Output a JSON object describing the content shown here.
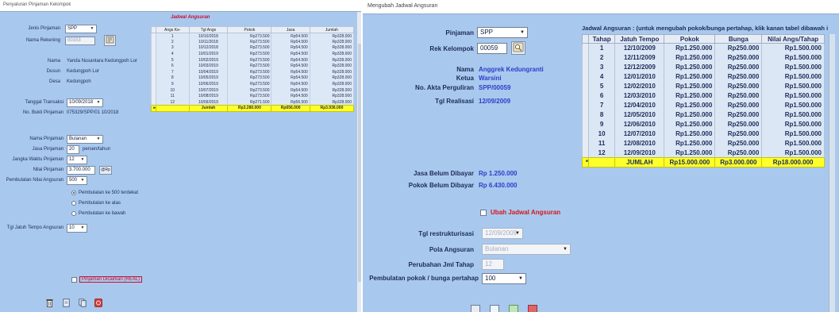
{
  "left_window": {
    "title": "Penyaluran Pinjaman Kelompok",
    "jenis_pinjaman": {
      "label": "Jenis Pinjaman",
      "value": "SPP"
    },
    "nama_rekening": {
      "label": "Nama Rekening",
      "value": "00153"
    },
    "nama": {
      "label": "Nama",
      "value": "Yanda Nusantara Kedungpoh Lor"
    },
    "dusun": {
      "label": "Dusun",
      "value": "Kedungpoh Lor"
    },
    "desa": {
      "label": "Desa",
      "value": "Kedungpoh"
    },
    "tanggal_transaksi": {
      "label": "Tanggal Transaksi",
      "value": "10/09/2018"
    },
    "no_bukti": {
      "label": "No. Bukti Pinjaman",
      "value": "075329/SPP/01 10/2018"
    },
    "nama_pinjaman": {
      "label": "Nama Pinjaman",
      "value": "Bulanan"
    },
    "jasa_pinjaman": {
      "label": "Jasa Pinjaman",
      "value": "20",
      "unit": "persen/tahun"
    },
    "jangka_waktu": {
      "label": "Jangka Waktu Pinjaman",
      "value": "12"
    },
    "nilai_pinjaman": {
      "label": "Nilai Pinjaman",
      "value": "3.700.000",
      "button": "@Rp"
    },
    "pembulatan": {
      "label": "Pembulatan Nilai Angsuran",
      "value": "500"
    },
    "radio_options": [
      "Pembulatan ke 500 terdekat",
      "Pembulatan ke atas",
      "Pembulatan ke bawah"
    ],
    "tgl_jatuh_tempo": {
      "label": "Tgl Jatuh Tempo Angsuran",
      "value": "10"
    },
    "checkbox_label": "Pinjaman Dicairkan (REAL)",
    "schedule": {
      "heading": "Jadwal Angsuran",
      "columns": [
        "Angs Ke-",
        "Tgl Angs",
        "Pokok",
        "Jasa",
        "Jumlah"
      ],
      "rows": [
        [
          "1",
          "10/10/2018",
          "Rp273.500",
          "Rp54.500",
          "Rp328.000"
        ],
        [
          "2",
          "10/11/2018",
          "Rp273.500",
          "Rp54.500",
          "Rp328.000"
        ],
        [
          "3",
          "10/12/2018",
          "Rp273.500",
          "Rp54.500",
          "Rp328.000"
        ],
        [
          "4",
          "10/01/2019",
          "Rp273.500",
          "Rp54.500",
          "Rp328.000"
        ],
        [
          "5",
          "10/02/2019",
          "Rp273.500",
          "Rp54.500",
          "Rp328.000"
        ],
        [
          "6",
          "10/03/2019",
          "Rp273.500",
          "Rp54.500",
          "Rp328.000"
        ],
        [
          "7",
          "10/04/2019",
          "Rp273.500",
          "Rp54.500",
          "Rp328.000"
        ],
        [
          "8",
          "10/05/2019",
          "Rp273.500",
          "Rp54.500",
          "Rp328.000"
        ],
        [
          "9",
          "10/06/2019",
          "Rp273.500",
          "Rp54.500",
          "Rp328.000"
        ],
        [
          "10",
          "10/07/2019",
          "Rp273.500",
          "Rp54.500",
          "Rp328.000"
        ],
        [
          "11",
          "10/08/2019",
          "Rp273.500",
          "Rp54.500",
          "Rp328.000"
        ],
        [
          "12",
          "10/09/2019",
          "Rp271.500",
          "Rp56.500",
          "Rp328.000"
        ]
      ],
      "total": [
        "",
        "Jumlah",
        "Rp3.280.000",
        "Rp656.000",
        "Rp3.936.000"
      ]
    }
  },
  "right_window": {
    "title": "Mengubah Jadwal Angsuran",
    "pinjaman": {
      "label": "Pinjaman",
      "value": "SPP"
    },
    "rek_kelompok": {
      "label": "Rek Kelompok",
      "value": "00059"
    },
    "nama": {
      "label": "Nama",
      "value": "Anggrek Kedungranti"
    },
    "ketua": {
      "label": "Ketua",
      "value": "Warsini"
    },
    "no_akta": {
      "label": "No. Akta Perguliran",
      "value": "SPP/00059"
    },
    "tgl_realisasi": {
      "label": "Tgl Realisasi",
      "value": "12/09/2009"
    },
    "jasa_belum": {
      "label": "Jasa Belum Dibayar",
      "value": "Rp 1.250.000"
    },
    "pokok_belum": {
      "label": "Pokok Belum Dibayar",
      "value": "Rp 6.430.000"
    },
    "ubah_checkbox": "Ubah Jadwal Angsuran",
    "tgl_restrukturisasi": {
      "label": "Tgl restrukturisasi",
      "value": "12/09/2009"
    },
    "pola_angsuran": {
      "label": "Pola Angsuran",
      "value": "Bulanan"
    },
    "perubahan_jml": {
      "label": "Perubahan Jml Tahap",
      "value": "12"
    },
    "pembulatan": {
      "label": "Pembulatan pokok / bunga pertahap",
      "value": "100"
    },
    "table": {
      "heading": "Jadwal Angsuran : (untuk mengubah pokok/bunga pertahap, klik kanan tabel dibawah i",
      "columns": [
        "Tahap",
        "Jatuh Tempo",
        "Pokok",
        "Bunga",
        "Nilai Angs/Tahap"
      ],
      "rows": [
        [
          "1",
          "12/10/2009",
          "Rp1.250.000",
          "Rp250.000",
          "Rp1.500.000"
        ],
        [
          "2",
          "12/11/2009",
          "Rp1.250.000",
          "Rp250.000",
          "Rp1.500.000"
        ],
        [
          "3",
          "12/12/2009",
          "Rp1.250.000",
          "Rp250.000",
          "Rp1.500.000"
        ],
        [
          "4",
          "12/01/2010",
          "Rp1.250.000",
          "Rp250.000",
          "Rp1.500.000"
        ],
        [
          "5",
          "12/02/2010",
          "Rp1.250.000",
          "Rp250.000",
          "Rp1.500.000"
        ],
        [
          "6",
          "12/03/2010",
          "Rp1.250.000",
          "Rp250.000",
          "Rp1.500.000"
        ],
        [
          "7",
          "12/04/2010",
          "Rp1.250.000",
          "Rp250.000",
          "Rp1.500.000"
        ],
        [
          "8",
          "12/05/2010",
          "Rp1.250.000",
          "Rp250.000",
          "Rp1.500.000"
        ],
        [
          "9",
          "12/06/2010",
          "Rp1.250.000",
          "Rp250.000",
          "Rp1.500.000"
        ],
        [
          "10",
          "12/07/2010",
          "Rp1.250.000",
          "Rp250.000",
          "Rp1.500.000"
        ],
        [
          "11",
          "12/08/2010",
          "Rp1.250.000",
          "Rp250.000",
          "Rp1.500.000"
        ],
        [
          "12",
          "12/09/2010",
          "Rp1.250.000",
          "Rp250.000",
          "Rp1.500.000"
        ]
      ],
      "total": [
        "",
        "JUMLAH",
        "Rp15.000.000",
        "Rp3.000.000",
        "Rp18.000.000"
      ]
    }
  },
  "icons": {
    "row_marker": "▸",
    "dropdown": "▼",
    "total_marker": "*",
    "search": "lookup-icon",
    "toolbar": [
      "delete-icon",
      "new-icon",
      "copy-icon",
      "close-icon"
    ]
  },
  "colors": {
    "panel": "#a9c8ee",
    "total_row": "#ffff2a",
    "value_text": "#2a3fc8",
    "red_heading": "#c8102e"
  }
}
